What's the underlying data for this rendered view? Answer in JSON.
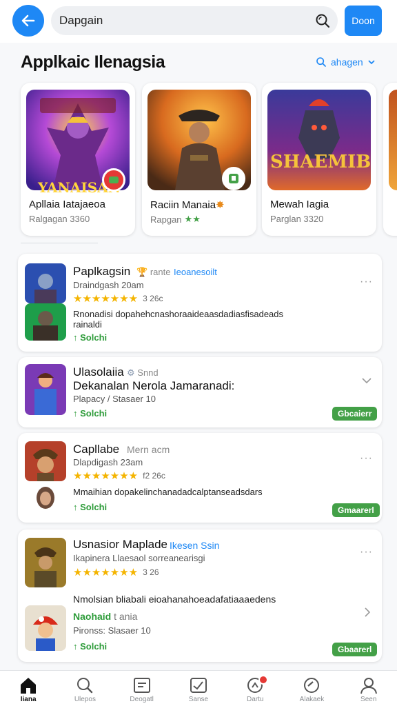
{
  "header": {
    "search_value": "Dapgain",
    "done_label": "Doon"
  },
  "section": {
    "title": "Applkaic Ilenagsia",
    "action_label": "ahagen"
  },
  "featured": [
    {
      "art_title": "YANAISAN",
      "title": "Apllaia Iatajaeoa",
      "subtitle": "Ralgagan 3360",
      "stars": ""
    },
    {
      "art_title": "",
      "title": "Raciin Manaia",
      "subtitle": "Rapgan",
      "stars": "★★"
    },
    {
      "art_title": "SHAEMIB",
      "title": "Mewah Iagia",
      "subtitle": "Parglan 3320",
      "stars": ""
    }
  ],
  "list": [
    {
      "title": "Paplkagsin",
      "dev": "rante",
      "dev2": "Ieoanesoilt",
      "meta": "Draindgash 20am",
      "stars": "★★★★★★★",
      "score": "3 26c",
      "desc": "Rnonadisi dopahehcnashoraaideaasdadiasfisadeads",
      "extra": "rainaldi",
      "status": "↑ Solchi",
      "pill": "",
      "more": "···"
    },
    {
      "title": "Ulasolaiia",
      "dev": "Snnd",
      "subtitle": "Dekanalan Nerola Jamaranadi:",
      "meta": "Plapacy / Stasaer 10",
      "status": "↑ Solchi",
      "pill": "Gbcaierr"
    },
    {
      "title": "Capllabe",
      "dev": "Mern acm",
      "meta": "Dlapdigash 23am",
      "stars": "★★★★★★★",
      "score": "f2 26c",
      "desc": "Mmaihian dopakelinchanadadcalptanseadsdars",
      "status": "↑ Solchi",
      "pill": "Gmaarerl",
      "more": "···"
    },
    {
      "title": "Usnasior Maplade",
      "dev": "Ikesen Ssin",
      "meta": "Ikapinera Llaesaol sorreanearisgi",
      "stars": "★★★★★★★",
      "score": "3 26",
      "desc": "Nmolsian bliabali eioahanahoeadafatiaaaedens",
      "sub2": "Naohaid",
      "sub2b": "t ania",
      "meta2": "Pironss: Slasaer 10",
      "status": "↑ Solchi",
      "pill": "Gbaarerl",
      "more": "···"
    }
  ],
  "nav": [
    {
      "label": "Iiana"
    },
    {
      "label": "Ulepos"
    },
    {
      "label": "Deogatl"
    },
    {
      "label": "Sanse"
    },
    {
      "label": "Dartu"
    },
    {
      "label": "Alakaek"
    },
    {
      "label": "Seen"
    }
  ],
  "colors": {
    "accent": "#1e88f5",
    "green": "#43a047",
    "star": "#f4b400"
  }
}
